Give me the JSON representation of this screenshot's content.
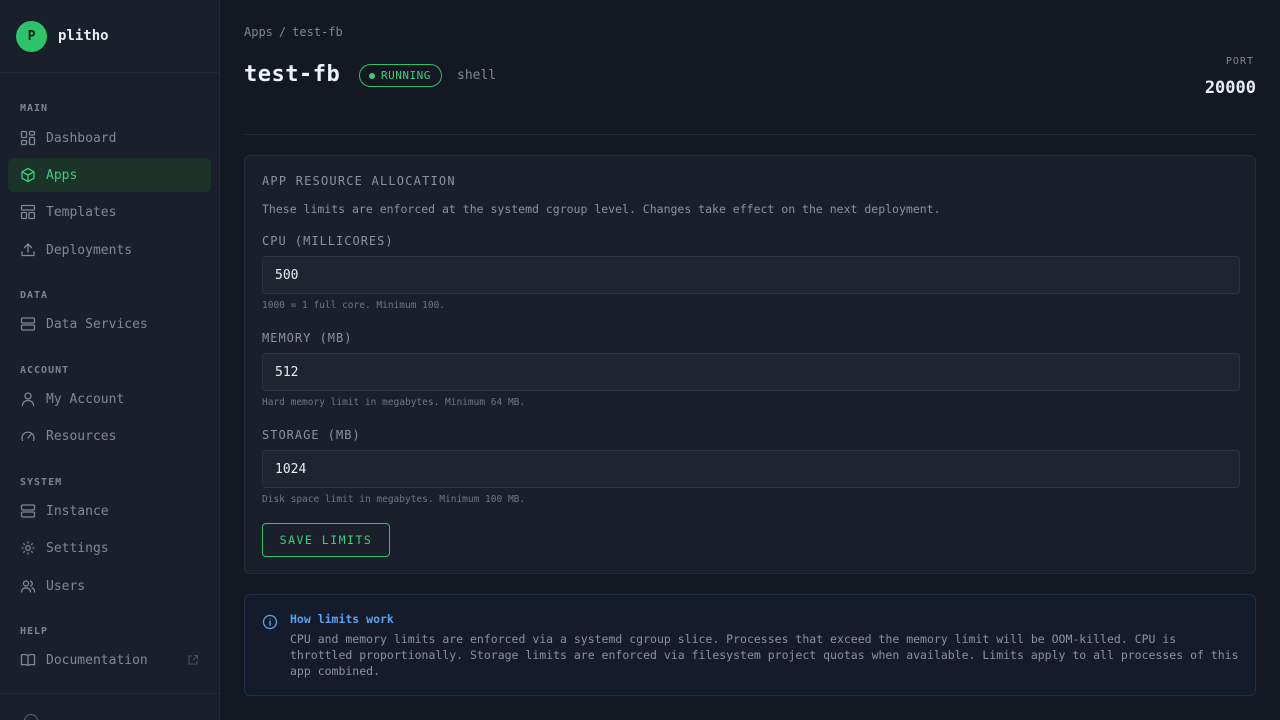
{
  "brand": {
    "logo_letter": "P",
    "name": "plitho",
    "accent": "#2cc36b"
  },
  "sidebar": {
    "sections": [
      {
        "label": "MAIN"
      },
      {
        "label": "DATA"
      },
      {
        "label": "ACCOUNT"
      },
      {
        "label": "SYSTEM"
      },
      {
        "label": "HELP"
      }
    ],
    "items": [
      {
        "label": "Dashboard",
        "icon": "grid-icon"
      },
      {
        "label": "Apps",
        "icon": "cube-icon",
        "active": true
      },
      {
        "label": "Templates",
        "icon": "layout-icon"
      },
      {
        "label": "Deployments",
        "icon": "upload-icon"
      },
      {
        "label": "Data Services",
        "icon": "database-icon"
      },
      {
        "label": "My Account",
        "icon": "user-icon"
      },
      {
        "label": "Resources",
        "icon": "gauge-icon"
      },
      {
        "label": "Instance",
        "icon": "server-icon"
      },
      {
        "label": "Settings",
        "icon": "gear-icon"
      },
      {
        "label": "Users",
        "icon": "users-icon"
      },
      {
        "label": "Documentation",
        "icon": "book-icon",
        "external": true
      }
    ]
  },
  "breadcrumb": {
    "parent": "Apps",
    "separator": "/",
    "current": "test-fb"
  },
  "header": {
    "title": "test-fb",
    "status": "RUNNING",
    "kind": "shell",
    "port_label": "PORT",
    "port_value": "20000"
  },
  "resources": {
    "title": "APP RESOURCE ALLOCATION",
    "description": "These limits are enforced at the systemd cgroup level. Changes take effect on the next deployment.",
    "fields": [
      {
        "label": "CPU (MILLICORES)",
        "value": "500",
        "hint": "1000 = 1 full core. Minimum 100."
      },
      {
        "label": "MEMORY (MB)",
        "value": "512",
        "hint": "Hard memory limit in megabytes. Minimum 64 MB."
      },
      {
        "label": "STORAGE (MB)",
        "value": "1024",
        "hint": "Disk space limit in megabytes. Minimum 100 MB."
      }
    ],
    "save_label": "SAVE LIMITS"
  },
  "info": {
    "title": "How limits work",
    "text": "CPU and memory limits are enforced via a systemd cgroup slice. Processes that exceed the memory limit will be OOM-killed. CPU is throttled proportionally. Storage limits are enforced via filesystem project quotas when available. Limits apply to all processes of this app combined."
  },
  "colors": {
    "status_green": "#3ecf78",
    "info_blue": "#5aa2f0",
    "background": "#131822"
  }
}
